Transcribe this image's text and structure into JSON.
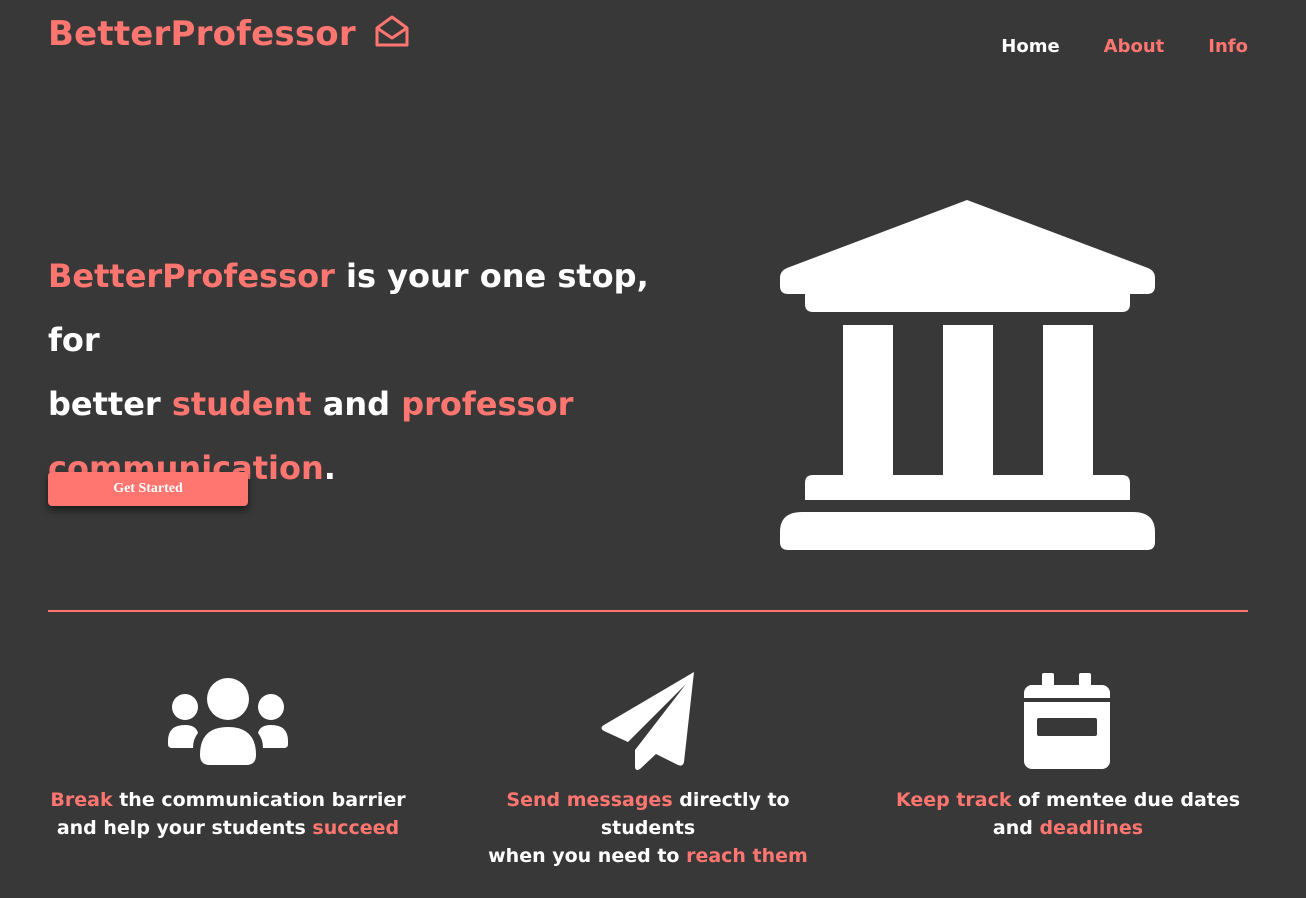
{
  "brand": {
    "name": "BetterProfessor",
    "icon": "envelope-open-icon",
    "color": "#ff7570"
  },
  "nav": {
    "home": "Home",
    "about": "About",
    "info": "Info"
  },
  "hero": {
    "brand": "BetterProfessor",
    "t1": " is your one stop, for",
    "t2": "better ",
    "student": "student",
    "t3": " and ",
    "professor": "professor",
    "communication": "communication",
    "period": ".",
    "cta": "Get Started",
    "image_icon": "building-columns-icon"
  },
  "features": [
    {
      "icon": "users-icon",
      "accent1": "Break",
      "text1": " the communication barrier",
      "text2": "and help your students ",
      "accent2": "succeed"
    },
    {
      "icon": "paper-plane-icon",
      "accent1": "Send messages",
      "text1": " directly to students",
      "text2": "when you need to ",
      "accent2": "reach them"
    },
    {
      "icon": "calendar-icon",
      "accent1": "Keep track",
      "text1": " of mentee due dates",
      "text2": "and ",
      "accent2": "deadlines"
    }
  ],
  "colors": {
    "background": "#383838",
    "accent": "#ff7570",
    "text": "#ffffff"
  }
}
